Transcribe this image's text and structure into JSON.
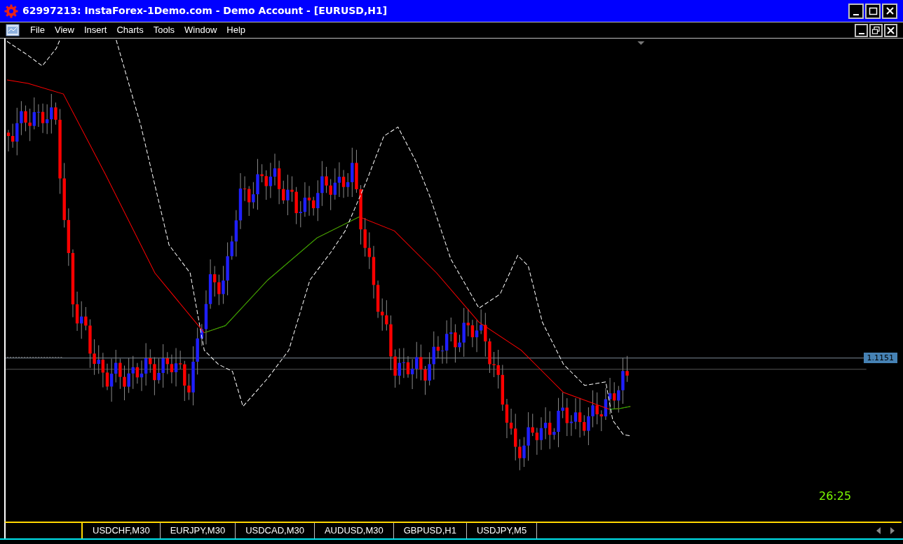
{
  "window": {
    "title": "62997213: InstaForex-1Demo.com - Demo Account - [EURUSD,H1]"
  },
  "menu": [
    "File",
    "View",
    "Insert",
    "Charts",
    "Tools",
    "Window",
    "Help"
  ],
  "chart": {
    "price_label": "1.1151",
    "timer": "26:25"
  },
  "tabs": [
    {
      "label": "USDCHF,M30"
    },
    {
      "label": "EURJPY,M30"
    },
    {
      "label": "USDCAD,M30"
    },
    {
      "label": "AUDUSD,M30"
    },
    {
      "label": "GBPUSD,H1"
    },
    {
      "label": "USDJPY,M5"
    }
  ]
}
